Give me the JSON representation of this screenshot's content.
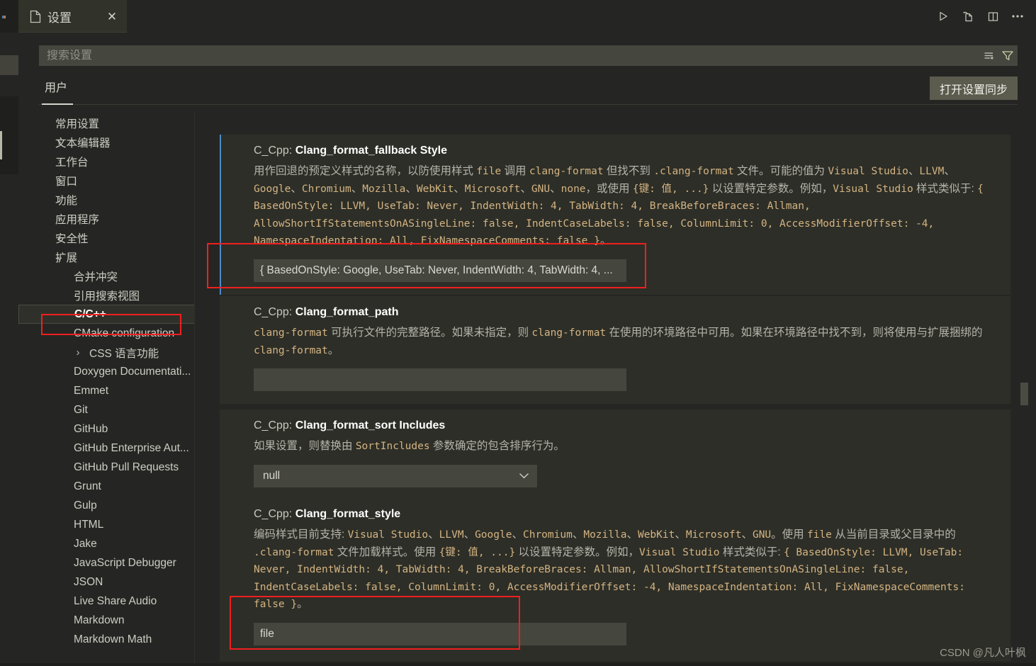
{
  "window": {
    "tab": {
      "title": "设置",
      "icon": "file-icon",
      "close_icon": "close-icon"
    },
    "actions": [
      {
        "name": "run-icon",
        "label": "运行"
      },
      {
        "name": "open-to-side-icon",
        "label": "在侧边打开"
      },
      {
        "name": "split-editor-icon",
        "label": "拆分编辑器"
      },
      {
        "name": "more-actions-icon",
        "label": "..."
      }
    ]
  },
  "search": {
    "placeholder": "搜索设置",
    "value": "",
    "clear_icon": "clear-search-icon",
    "filter_icon": "filter-icon"
  },
  "scope": {
    "tab_label": "用户",
    "sync_button": "打开设置同步"
  },
  "tree": {
    "items": [
      {
        "label": "常用设置",
        "level": 0,
        "twisty": ""
      },
      {
        "label": "文本编辑器",
        "level": 0,
        "twisty": "collapsed"
      },
      {
        "label": "工作台",
        "level": 0,
        "twisty": "collapsed"
      },
      {
        "label": "窗口",
        "level": 0,
        "twisty": "collapsed"
      },
      {
        "label": "功能",
        "level": 0,
        "twisty": "collapsed"
      },
      {
        "label": "应用程序",
        "level": 0,
        "twisty": "collapsed"
      },
      {
        "label": "安全性",
        "level": 0,
        "twisty": "collapsed"
      },
      {
        "label": "扩展",
        "level": 0,
        "twisty": "expanded"
      },
      {
        "label": "合并冲突",
        "level": 1,
        "twisty": ""
      },
      {
        "label": "引用搜索视图",
        "level": 1,
        "twisty": ""
      },
      {
        "label": "C/C++",
        "level": 1,
        "twisty": "",
        "selected": true
      },
      {
        "label": "CMake configuration",
        "level": 1,
        "twisty": ""
      },
      {
        "label": "CSS 语言功能",
        "level": 1,
        "twisty": "collapsed"
      },
      {
        "label": "Doxygen Documentati...",
        "level": 1,
        "twisty": ""
      },
      {
        "label": "Emmet",
        "level": 1,
        "twisty": ""
      },
      {
        "label": "Git",
        "level": 1,
        "twisty": ""
      },
      {
        "label": "GitHub",
        "level": 1,
        "twisty": ""
      },
      {
        "label": "GitHub Enterprise Aut...",
        "level": 1,
        "twisty": ""
      },
      {
        "label": "GitHub Pull Requests",
        "level": 1,
        "twisty": ""
      },
      {
        "label": "Grunt",
        "level": 1,
        "twisty": ""
      },
      {
        "label": "Gulp",
        "level": 1,
        "twisty": ""
      },
      {
        "label": "HTML",
        "level": 1,
        "twisty": ""
      },
      {
        "label": "Jake",
        "level": 1,
        "twisty": ""
      },
      {
        "label": "JavaScript Debugger",
        "level": 1,
        "twisty": ""
      },
      {
        "label": "JSON",
        "level": 1,
        "twisty": ""
      },
      {
        "label": "Live Share Audio",
        "level": 1,
        "twisty": ""
      },
      {
        "label": "Markdown",
        "level": 1,
        "twisty": ""
      },
      {
        "label": "Markdown Math",
        "level": 1,
        "twisty": ""
      }
    ]
  },
  "settings": [
    {
      "prefix": "C_Cpp: ",
      "name": "Clang_format_fallback Style",
      "desc_html": "用作回退的预定义样式的名称，以防使用样式 <span class=\"code\">file</span> 调用 <span class=\"code\">clang-format</span> 但找不到 <span class=\"code\">.clang-format</span> 文件。可能的值为 <span class=\"code\">Visual Studio</span>、<span class=\"code\">LLVM</span>、<span class=\"code\">Google</span>、<span class=\"code\">Chromium</span>、<span class=\"code\">Mozilla</span>、<span class=\"code\">WebKit</span>、<span class=\"code\">Microsoft</span>、<span class=\"code\">GNU</span>、<span class=\"code\">none</span>，或使用 <span class=\"code\">{键: 值, ...}</span> 以设置特定参数。例如，<span class=\"code\">Visual Studio</span> 样式类似于: <span class=\"code\">{ BasedOnStyle: LLVM, UseTab: Never, IndentWidth: 4, TabWidth: 4, BreakBeforeBraces: Allman, AllowShortIfStatementsOnASingleLine: false, IndentCaseLabels: false, ColumnLimit: 0, AccessModifierOffset: -4, NamespaceIndentation: All, FixNamespaceComments: false }</span>。",
      "control": "text",
      "value": "{ BasedOnStyle: Google, UseTab: Never, IndentWidth: 4, TabWidth: 4, ...",
      "modified": true
    },
    {
      "prefix": "C_Cpp: ",
      "name": "Clang_format_path",
      "desc_html": "<span class=\"code\">clang-format</span> 可执行文件的完整路径。如果未指定，则 <span class=\"code\">clang-format</span> 在使用的环境路径中可用。如果在环境路径中找不到，则将使用与扩展捆绑的 <span class=\"code\">clang-format</span>。",
      "control": "text",
      "value": "",
      "modified": false
    },
    {
      "prefix": "C_Cpp: ",
      "name": "Clang_format_sort Includes",
      "desc_html": "如果设置，则替换由 <span class=\"code\">SortIncludes</span> 参数确定的包含排序行为。",
      "control": "select",
      "value": "null",
      "options": [
        "null",
        "true",
        "false"
      ],
      "modified": false
    },
    {
      "prefix": "C_Cpp: ",
      "name": "Clang_format_style",
      "desc_html": "编码样式目前支持: <span class=\"code\">Visual Studio</span>、<span class=\"code\">LLVM</span>、<span class=\"code\">Google</span>、<span class=\"code\">Chromium</span>、<span class=\"code\">Mozilla</span>、<span class=\"code\">WebKit</span>、<span class=\"code\">Microsoft</span>、<span class=\"code\">GNU</span>。使用 <span class=\"code\">file</span> 从当前目录或父目录中的 <span class=\"code\">.clang-format</span> 文件加载样式。使用 <span class=\"code\">{键: 值, ...}</span> 以设置特定参数。例如，<span class=\"code\">Visual Studio</span> 样式类似于: <span class=\"code\">{ BasedOnStyle: LLVM, UseTab: Never, IndentWidth: 4, TabWidth: 4, BreakBeforeBraces: Allman, AllowShortIfStatementsOnASingleLine: false, IndentCaseLabels: false, ColumnLimit: 0, AccessModifierOffset: -4, NamespaceIndentation: All, FixNamespaceComments: false }</span>。",
      "control": "text",
      "value": "file",
      "modified": false
    }
  ],
  "annotations": {
    "accent_color": "#f01f1f",
    "boxes": [
      "tree-selected-c-cpp",
      "fallback-style-value",
      "clang-format-style-value"
    ]
  },
  "watermark": "CSDN @凡人叶枫"
}
